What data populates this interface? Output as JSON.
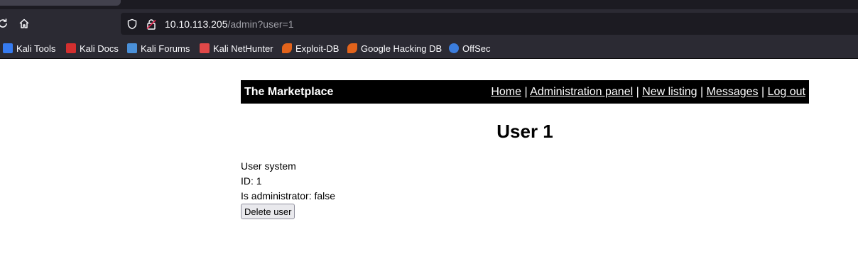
{
  "browser": {
    "url_host": "10.10.113.205",
    "url_path": "/admin?user=1",
    "bookmarks": [
      {
        "label": "Kali Tools",
        "icon": "kali-tools-icon",
        "color": "#367bf0"
      },
      {
        "label": "Kali Docs",
        "icon": "kali-docs-icon",
        "color": "#d32f2f"
      },
      {
        "label": "Kali Forums",
        "icon": "kali-forums-icon",
        "color": "#4a90d9"
      },
      {
        "label": "Kali NetHunter",
        "icon": "kali-nethunter-icon",
        "color": "#e04848"
      },
      {
        "label": "Exploit-DB",
        "icon": "exploit-db-icon",
        "color": "#e2631b"
      },
      {
        "label": "Google Hacking DB",
        "icon": "ghdb-icon",
        "color": "#e2631b"
      },
      {
        "label": "OffSec",
        "icon": "offsec-icon",
        "color": "#3b7ddd"
      }
    ]
  },
  "site": {
    "brand": "The Marketplace",
    "nav": {
      "home": "Home",
      "admin": "Administration panel",
      "new_listing": "New listing",
      "messages": "Messages",
      "logout": "Log out",
      "separator": "|"
    }
  },
  "page": {
    "title": "User 1",
    "user_line": "User system",
    "id_line": "ID: 1",
    "admin_line": "Is administrator: false",
    "delete_button": "Delete user"
  }
}
